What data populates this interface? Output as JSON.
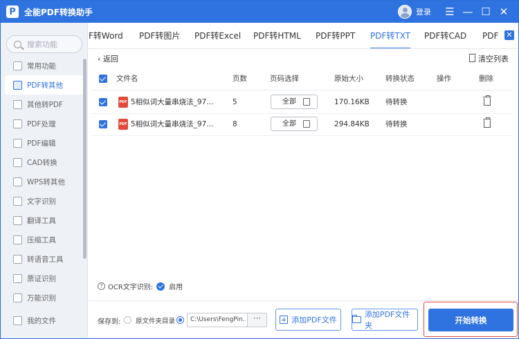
{
  "app": {
    "title": "全能PDF转换助手",
    "logo_letter": "P",
    "login": "登录"
  },
  "window": {
    "menu_glyph": "☰",
    "minimize_glyph": "—",
    "maximize_glyph": "☐",
    "close_glyph": "✕"
  },
  "sidebar": {
    "search_placeholder": "搜索功能",
    "items": [
      {
        "label": "常用功能"
      },
      {
        "label": "PDF转其他"
      },
      {
        "label": "其他转PDF"
      },
      {
        "label": "PDF处理"
      },
      {
        "label": "PDF编辑"
      },
      {
        "label": "CAD转换"
      },
      {
        "label": "WPS转其他"
      },
      {
        "label": "文字识别"
      },
      {
        "label": "翻译工具"
      },
      {
        "label": "压缩工具"
      },
      {
        "label": "转语音工具"
      },
      {
        "label": "票证识别"
      },
      {
        "label": "万能识别"
      }
    ],
    "active_index": 1,
    "my_files": "我的文件"
  },
  "tabs": {
    "items": [
      "F转Word",
      "PDF转图片",
      "PDF转Excel",
      "PDF转HTML",
      "PDF转PPT",
      "PDF转TXT",
      "PDF转CAD",
      "PDF"
    ],
    "active": "PDF转TXT",
    "close_glyph": "✕"
  },
  "toolbar": {
    "back_label": "‹  返回",
    "clear_label": "清空列表"
  },
  "table": {
    "headers": {
      "filename": "文件名",
      "pages": "页数",
      "range": "页码选择",
      "size": "原始大小",
      "status": "转换状态",
      "action": "操作",
      "delete": "删除"
    },
    "rows": [
      {
        "filename": "5相似词大量串烧法_97...",
        "pages": "5",
        "range": "全部",
        "size": "170.16KB",
        "status": "待转换"
      },
      {
        "filename": "5相似词大量串烧法_97...",
        "pages": "8",
        "range": "全部",
        "size": "294.84KB",
        "status": "待转换"
      }
    ]
  },
  "ocr": {
    "label": "OCR文字识别:",
    "value": "启用"
  },
  "bottom": {
    "save_to": "保存到:",
    "option_source": "原文件夹目录",
    "path": "C:\\Users\\FengPin...",
    "path_more": "···",
    "add_pdf": "添加PDF文件",
    "add_folder": "添加PDF文件夹",
    "start": "开始转换"
  },
  "colors": {
    "accent": "#2f73e0",
    "highlight_border": "#e04a3a",
    "pdf_icon": "#e24a3b"
  }
}
